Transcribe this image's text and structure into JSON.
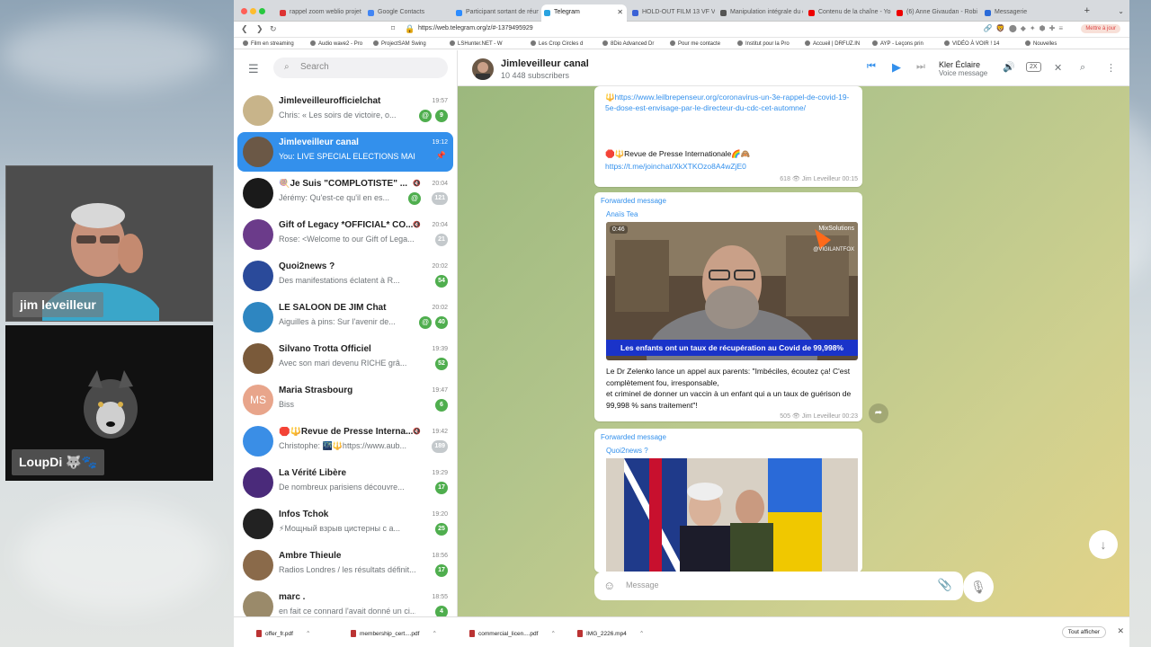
{
  "participants": [
    {
      "name": "jim leveilleur"
    },
    {
      "name": "LoupDi 🐺🐾"
    }
  ],
  "browser": {
    "tabs": [
      {
        "label": "rappel zoom weblio projet",
        "color": "#d33"
      },
      {
        "label": "Google Contacts",
        "color": "#4285f4"
      },
      {
        "label": "Participant sortant de réun",
        "color": "#2d8cff"
      },
      {
        "label": "Telegram",
        "color": "#2aa3e0"
      },
      {
        "label": "HOLD-OUT FILM 13 VF V2",
        "color": "#3b62d6"
      },
      {
        "label": "Manipulation intégrale du co",
        "color": "#555"
      },
      {
        "label": "Contenu de la chaîne - You",
        "color": "#e00"
      },
      {
        "label": "(6) Anne Givaudan - Robi",
        "color": "#e00"
      },
      {
        "label": "Messagerie",
        "color": "#2a6ad8"
      }
    ],
    "url": "https://web.telegram.org/z/#-1379495929",
    "update_label": "Mettre à jour",
    "bookmarks": [
      "Film en streaming",
      "Audio wave2 - Pro",
      "ProjectSAM Swing",
      "LSHunter.NET - W",
      "Les Crop Circles d",
      "8Dio Advanced Dr",
      "Pour me contacte",
      "Institut pour la Pro",
      "Accueil | DRFUZ.IN",
      "AYP - Leçons prin",
      "VIDÉO À VOIR ! 14",
      "Nouvelles"
    ]
  },
  "telegram": {
    "search_placeholder": "Search",
    "chats": [
      {
        "name": "Jimleveilleurofficielchat",
        "time": "19:57",
        "preview": "Chris: « Les soirs de victoire, o...",
        "badge": "9",
        "mention": true,
        "muted": false,
        "avcolor": "#c8b48a"
      },
      {
        "name": "Jimleveilleur canal",
        "time": "19:12",
        "preview": "You: LIVE SPECIAL ELECTIONS MAIN...",
        "badge": "",
        "pinned": true,
        "selected": true,
        "avcolor": "#6b5846"
      },
      {
        "name": "🍭Je Suis \"COMPLOTISTE\" ...",
        "time": "20:04",
        "preview": "Jérémy: Qu'est-ce qu'il en es...",
        "badge": "121",
        "mention": true,
        "muted": true,
        "avcolor": "#1a1a1a"
      },
      {
        "name": "Gift of Legacy *OFFICIAL* CO...",
        "time": "20:04",
        "preview": "Rose: <Welcome to our Gift of Lega...",
        "badge": "21",
        "muted": true,
        "avcolor": "#6b3b8a"
      },
      {
        "name": "Quoi2news ?",
        "time": "20:02",
        "preview": "Des manifestations éclatent à R...",
        "badge": "54",
        "avcolor": "#2a4a9a"
      },
      {
        "name": "LE SALOON DE JIM Chat",
        "time": "20:02",
        "preview": "Aiguilles à pins: Sur l'avenir de...",
        "badge": "40",
        "mention": true,
        "avcolor": "#2e86c1"
      },
      {
        "name": "Silvano Trotta Officiel",
        "time": "19:39",
        "preview": "Avec son mari devenu RICHE grâ...",
        "badge": "52",
        "avcolor": "#7a5a3a"
      },
      {
        "name": "Maria Strasbourg",
        "time": "19:47",
        "preview": "Biss",
        "badge": "6",
        "initials": "MS",
        "avcolor": "#e8a58b"
      },
      {
        "name": "🛑🔱Revue de Presse Interna...",
        "time": "19:42",
        "preview": "Christophe: 🌃🔱https://www.aub...",
        "badge": "189",
        "muted": true,
        "avcolor": "#3a8ee6"
      },
      {
        "name": "La Vérité Libère",
        "time": "19:29",
        "preview": "De nombreux parisiens découvre...",
        "badge": "17",
        "avcolor": "#4a2a7a"
      },
      {
        "name": "Infos Tchok",
        "time": "19:20",
        "preview": "⚡Мощный взрыв цистерны с а...",
        "badge": "25",
        "avcolor": "#222"
      },
      {
        "name": "Ambre Thieule",
        "time": "18:56",
        "preview": "Radios Londres / les résultats définit...",
        "badge": "17",
        "avcolor": "#8a6a4a"
      },
      {
        "name": "marc .",
        "time": "18:55",
        "preview": "en fait ce connard l'avait donné un ci...",
        "badge": "4",
        "avcolor": "#9a8a6a"
      }
    ],
    "header": {
      "title": "Jimleveilleur canal",
      "subscribers": "10 448 subscribers",
      "player_name": "Kler Éclaire",
      "player_note": "Voice message",
      "speed": "2X"
    },
    "messages": {
      "m1_link": "🔱https://www.leilbrepenseur.org/coronavirus-un-3e-rappel-de-covid-19-5e-dose-est-envisage-par-le-directeur-du-cdc-cet-automne/",
      "m1_text2": "🛑🔱Revue de Presse Internationale🌈🙈",
      "m1_link2": "https://t.me/joinchat/XkXTKOzo8A4wZjE0",
      "m1_meta": "618 👁 Jim Leveilleur 00:15",
      "m2_fwd": "Forwarded message",
      "m2_from": "Anaïs Tea",
      "m2_duration": "0:46",
      "m2_watermark": "MixSolutions",
      "m2_watermark2": "@VIGILANTFOX",
      "m2_caption": "Les enfants ont un taux de récupération au Covid de 99,998%",
      "m2_text": "Le Dr Zelenko lance un appel aux parents: \"Imbéciles, écoutez ça! C'est complètement fou, irresponsable,\net criminel de donner un vaccin à un enfant qui a un taux de guérison de 99,998 % sans traitement\"!",
      "m2_meta": "505 👁 Jim Leveilleur 00:23",
      "m3_fwd": "Forwarded message",
      "m3_from": "Quoi2news ?"
    },
    "composer_placeholder": "Message"
  },
  "downloads": {
    "items": [
      "offer_fr.pdf",
      "membership_cert....pdf",
      "commercial_licen....pdf",
      "IMG_2226.mp4"
    ],
    "show_all": "Tout afficher"
  }
}
